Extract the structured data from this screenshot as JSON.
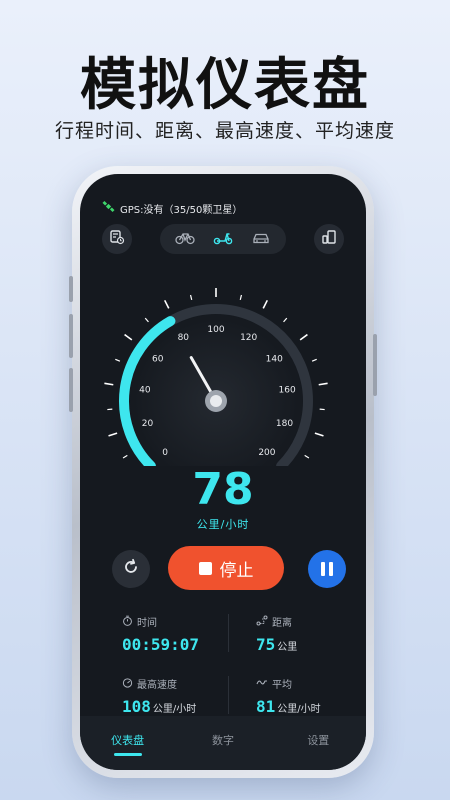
{
  "hero": {
    "title": "模拟仪表盘",
    "subtitle": "行程时间、距离、最高速度、平均速度"
  },
  "status_bar": {
    "gps_label": "GPS:没有（35/50颗卫星）",
    "icon": "satellite-icon"
  },
  "toolbar": {
    "left_icon": "trip-log-icon",
    "right_icon": "screen-mode-icon",
    "vehicle_modes": [
      {
        "name": "bicycle",
        "icon": "bicycle-icon",
        "active": false
      },
      {
        "name": "scooter",
        "icon": "scooter-icon",
        "active": true
      },
      {
        "name": "car",
        "icon": "car-icon",
        "active": false
      }
    ]
  },
  "gauge": {
    "tick_labels": [
      "0",
      "20",
      "40",
      "60",
      "80",
      "100",
      "120",
      "140",
      "160",
      "180",
      "200"
    ],
    "max": 200,
    "current": 78,
    "accent": "#3ee6ee"
  },
  "speed": {
    "value": "78",
    "unit": "公里/小时"
  },
  "controls": {
    "reset_icon": "refresh-icon",
    "stop_label": "停止",
    "pause_icon": "pause-icon",
    "stop_color": "#f0522e",
    "pause_color": "#2372e8"
  },
  "stats": {
    "time": {
      "label": "时间",
      "value": "00:59:07",
      "icon": "stopwatch-icon"
    },
    "distance": {
      "label": "距离",
      "value": "75",
      "unit": "公里",
      "icon": "route-icon"
    },
    "max_speed": {
      "label": "最高速度",
      "value": "108",
      "unit": "公里/小时",
      "icon": "speedometer-icon"
    },
    "avg_speed": {
      "label": "平均",
      "value": "81",
      "unit": "公里/小时",
      "icon": "wave-icon"
    }
  },
  "tabs": [
    {
      "label": "仪表盘",
      "active": true
    },
    {
      "label": "数字",
      "active": false
    },
    {
      "label": "设置",
      "active": false
    }
  ]
}
